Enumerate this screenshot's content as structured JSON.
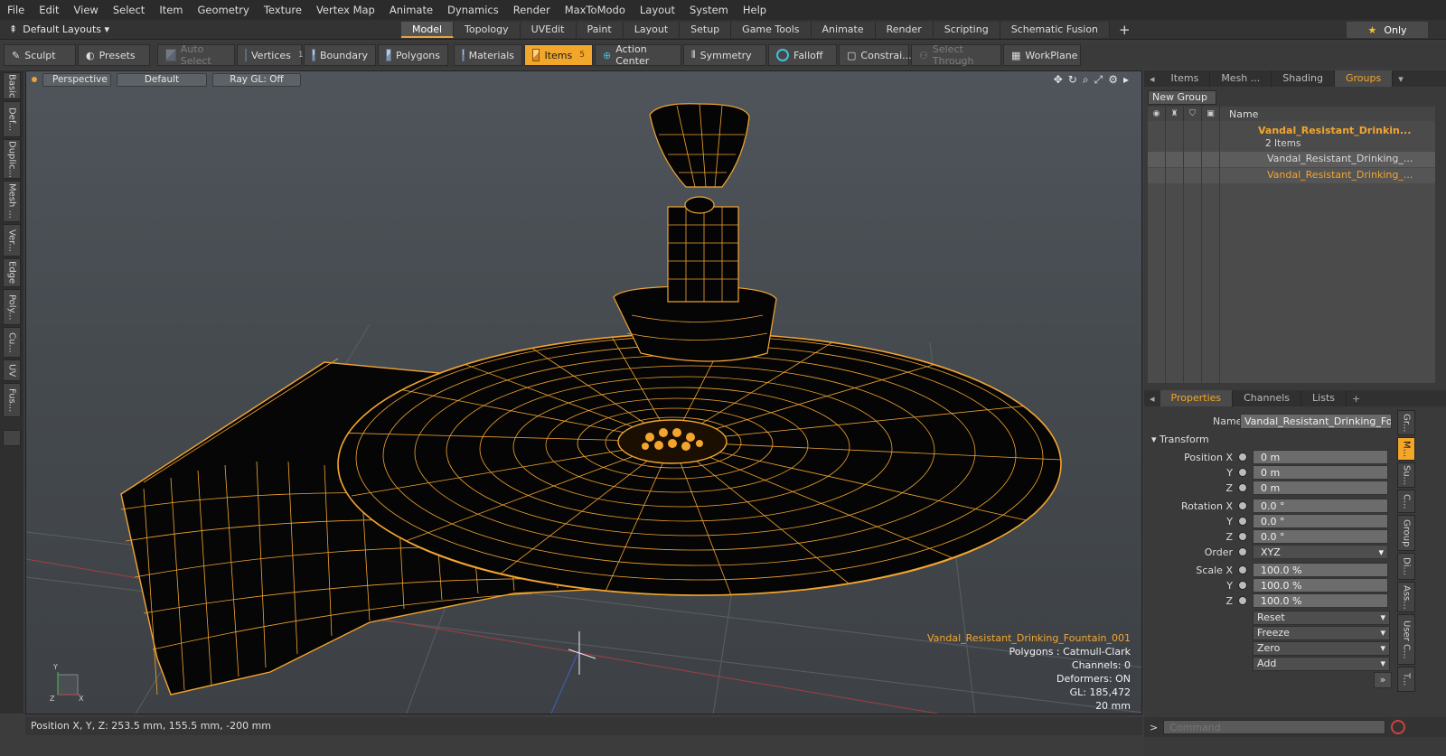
{
  "menu": [
    "File",
    "Edit",
    "View",
    "Select",
    "Item",
    "Geometry",
    "Texture",
    "Vertex Map",
    "Animate",
    "Dynamics",
    "Render",
    "MaxToModo",
    "Layout",
    "System",
    "Help"
  ],
  "layout_select": "Default Layouts ▾",
  "layout_tabs": [
    {
      "label": "Model",
      "active": true
    },
    {
      "label": "Topology"
    },
    {
      "label": "UVEdit"
    },
    {
      "label": "Paint"
    },
    {
      "label": "Layout"
    },
    {
      "label": "Setup"
    },
    {
      "label": "Game Tools"
    },
    {
      "label": "Animate"
    },
    {
      "label": "Render"
    },
    {
      "label": "Scripting"
    },
    {
      "label": "Schematic Fusion"
    }
  ],
  "only_label": "Only",
  "toolbar": {
    "sculpt": "Sculpt",
    "presets": "Presets",
    "auto_select": "Auto Select",
    "vertices": "Vertices",
    "vertices_num": "1",
    "boundary": "Boundary",
    "polygons": "Polygons",
    "materials": "Materials",
    "items": "Items",
    "items_num": "5",
    "action_center": "Action Center",
    "symmetry": "Symmetry",
    "falloff": "Falloff",
    "constraints": "Constrai...",
    "select_through": "Select Through",
    "workplane": "WorkPlane"
  },
  "left_tabs": [
    "Basic",
    "Def...",
    "Duplic...",
    "Mesh ...",
    "Ver...",
    "Edge",
    "Poly...",
    "Cu...",
    "UV",
    "Fus..."
  ],
  "viewport": {
    "view": "Perspective",
    "shading": "Default",
    "raygl": "Ray GL: Off",
    "info": {
      "name": "Vandal_Resistant_Drinking_Fountain_001",
      "polygons": "Polygons : Catmull-Clark",
      "channels": "Channels: 0",
      "deformers": "Deformers: ON",
      "gl": "GL: 185,472",
      "scale": "20 mm"
    }
  },
  "status": "Position X, Y, Z:  253.5 mm, 155.5 mm, -200 mm",
  "right_tabs_top": [
    {
      "label": "Items"
    },
    {
      "label": "Mesh ..."
    },
    {
      "label": "Shading"
    },
    {
      "label": "Groups",
      "active": true
    }
  ],
  "groups": {
    "new_group": "New Group",
    "header_name": "Name",
    "group_name": "Vandal_Resistant_Drinkin...",
    "group_count": "2 Items",
    "item1": "Vandal_Resistant_Drinking_...",
    "item2": "Vandal_Resistant_Drinking_..."
  },
  "prop_tabs": [
    {
      "label": "Properties",
      "active": true
    },
    {
      "label": "Channels"
    },
    {
      "label": "Lists"
    }
  ],
  "properties": {
    "name_label": "Name",
    "name_value": "Vandal_Resistant_Drinking_Fount",
    "transform": "Transform",
    "pos_x_label": "Position X",
    "pos_x": "0 m",
    "pos_y_label": "Y",
    "pos_y": "0 m",
    "pos_z_label": "Z",
    "pos_z": "0 m",
    "rot_x_label": "Rotation X",
    "rot_x": "0.0 °",
    "rot_y_label": "Y",
    "rot_y": "0.0 °",
    "rot_z_label": "Z",
    "rot_z": "0.0 °",
    "order_label": "Order",
    "order": "XYZ",
    "scl_x_label": "Scale X",
    "scl_x": "100.0 %",
    "scl_y_label": "Y",
    "scl_y": "100.0 %",
    "scl_z_label": "Z",
    "scl_z": "100.0 %",
    "reset": "Reset",
    "freeze": "Freeze",
    "zero": "Zero",
    "add": "Add"
  },
  "right_side_tabs": [
    "Gr...",
    "M...",
    "Su...",
    "C...",
    "Group",
    "Di...",
    "Ass...",
    "User C...",
    "T..."
  ],
  "command_placeholder": "Command",
  "colors": {
    "accent": "#f2a62a",
    "wire": "#f3a530",
    "mesh": "#050505"
  }
}
